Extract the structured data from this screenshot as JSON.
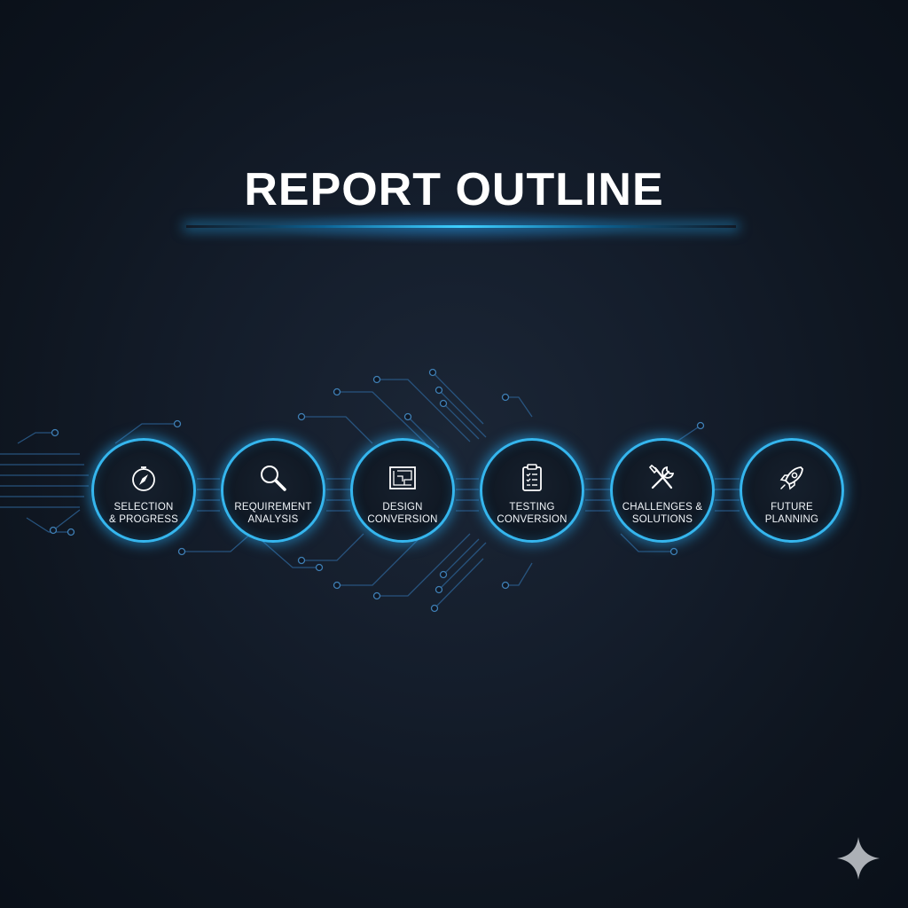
{
  "title": "REPORT OUTLINE",
  "steps": [
    {
      "line1": "SELECTION",
      "line2": "& PROGRESS",
      "icon": "compass-icon"
    },
    {
      "line1": "REQUIREMENT",
      "line2": "ANALYSIS",
      "icon": "magnifier-icon"
    },
    {
      "line1": "DESIGN",
      "line2": "CONVERSION",
      "icon": "blueprint-icon"
    },
    {
      "line1": "TESTING",
      "line2": "CONVERSION",
      "icon": "clipboard-checklist-icon"
    },
    {
      "line1": "CHALLENGES &",
      "line2": "SOLUTIONS",
      "icon": "wrench-screwdriver-icon"
    },
    {
      "line1": "FUTURE",
      "line2": "PLANNING",
      "icon": "rocket-icon"
    }
  ],
  "colors": {
    "background": "#0f1724",
    "accent": "#35b6ee",
    "title_text": "#ffffff",
    "circuit_line": "#2d5f8c"
  },
  "corner_mark": "sparkle-icon"
}
